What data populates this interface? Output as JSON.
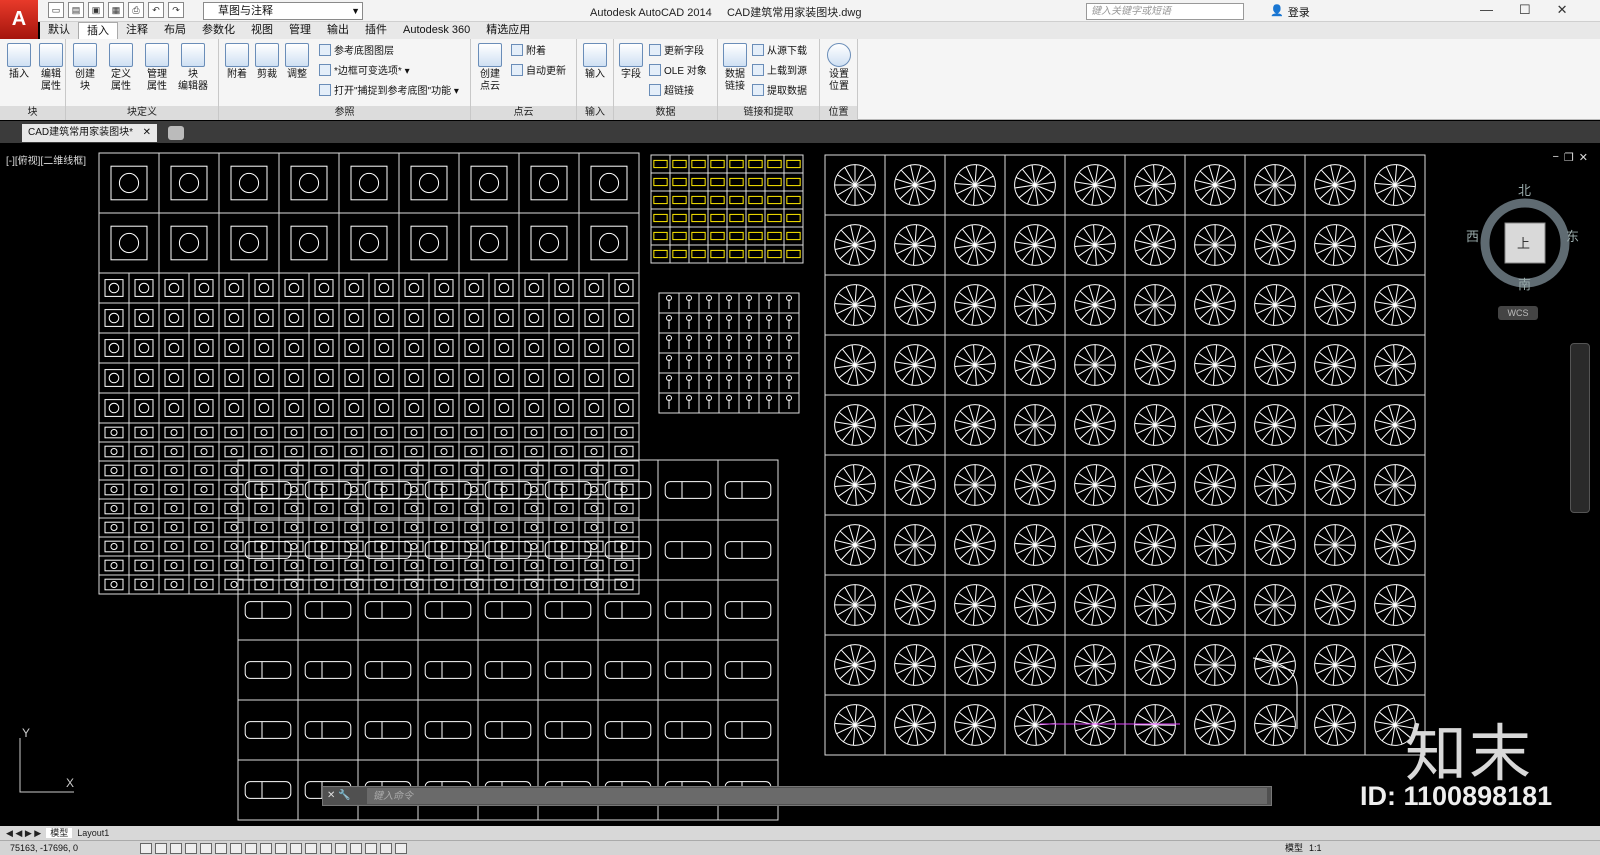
{
  "app": {
    "logo": "A",
    "title": "Autodesk AutoCAD 2014",
    "file": "CAD建筑常用家装图块.dwg"
  },
  "workspace": {
    "value": "草图与注释"
  },
  "search": {
    "placeholder": "键入关键字或短语"
  },
  "user": {
    "login": "登录"
  },
  "ribbon_tabs": [
    "默认",
    "插入",
    "注释",
    "布局",
    "参数化",
    "视图",
    "管理",
    "输出",
    "插件",
    "Autodesk 360",
    "精选应用"
  ],
  "ribbon": {
    "block": {
      "title": "块",
      "insert": "插入",
      "edit_attr": "编辑\n属性"
    },
    "blockdef": {
      "title": "块定义",
      "create": "创建\n块",
      "define": "定义\n属性",
      "manage": "管理\n属性",
      "editor": "块\n编辑器"
    },
    "ref": {
      "title": "参照",
      "attach": "附着",
      "clip": "剪裁",
      "adjust": "调整",
      "underlay_layers": "参考底图图层",
      "frames": "*边框可变选项*",
      "snap": "打开\"捕捉到参考底图\"功能"
    },
    "cloud": {
      "title": "点云",
      "create": "创建\n点云",
      "attach": "附着",
      "autoupdate": "自动更新"
    },
    "import": {
      "title": "输入",
      "import": "输入"
    },
    "data": {
      "title": "数据",
      "field": "字段",
      "update_fields": "更新字段",
      "ole": "OLE 对象",
      "hyperlink": "超链接"
    },
    "link": {
      "title": "链接和提取",
      "data_link": "数据\n链接",
      "download": "从源下载",
      "upload": "上载到源",
      "extract": "提取数据"
    },
    "location": {
      "title": "位置",
      "set": "设置\n位置"
    }
  },
  "doc_tab": {
    "label": "CAD建筑常用家装图块*"
  },
  "viewport": {
    "label": "[-][俯视][二维线框]"
  },
  "viewcube": {
    "north": "北",
    "south": "南",
    "east": "东",
    "west": "西",
    "top": "上",
    "wcs": "WCS"
  },
  "ucs": {
    "x": "X",
    "y": "Y"
  },
  "cmdline": {
    "placeholder": "键入命令"
  },
  "layout_tabs": [
    "模型",
    "Layout1"
  ],
  "status": {
    "coords": "75163, -17696, 0",
    "model": "模型",
    "scale": "1:1"
  },
  "watermark": {
    "logo": "知末",
    "id": "ID: 1100898181"
  }
}
